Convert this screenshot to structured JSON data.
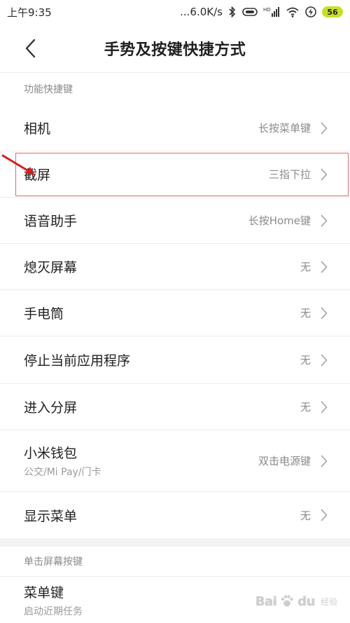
{
  "status_bar": {
    "time": "上午9:35",
    "network_speed": "...6.0K/s",
    "battery": "56",
    "icons": [
      "bluetooth-icon",
      "record-icon",
      "hd-signal-icon",
      "wifi-icon",
      "charging-icon",
      "battery-icon"
    ]
  },
  "header": {
    "title": "手势及按键快捷方式",
    "back_icon": "back-chevron-icon"
  },
  "sections": [
    {
      "header": "功能快捷键",
      "items": [
        {
          "label": "相机",
          "value": "长按菜单键"
        },
        {
          "label": "截屏",
          "value": "三指下拉"
        },
        {
          "label": "语音助手",
          "value": "长按Home键"
        },
        {
          "label": "熄灭屏幕",
          "value": "无"
        },
        {
          "label": "手电筒",
          "value": "无"
        },
        {
          "label": "停止当前应用程序",
          "value": "无"
        },
        {
          "label": "进入分屏",
          "value": "无"
        },
        {
          "label": "小米钱包",
          "sublabel": "公交/Mi Pay/门卡",
          "value": "双击电源键"
        },
        {
          "label": "显示菜单",
          "value": "无"
        }
      ]
    },
    {
      "header": "单击屏幕按键",
      "items": [
        {
          "label": "菜单键",
          "sublabel": "启动近期任务",
          "value": ""
        }
      ]
    }
  ],
  "watermark": {
    "text": "Bai",
    "paw": "du",
    "suffix": "经验"
  },
  "colors": {
    "highlight_border": "#e46a6a",
    "arrow": "#d21f1f",
    "battery": "#c8df2a"
  }
}
